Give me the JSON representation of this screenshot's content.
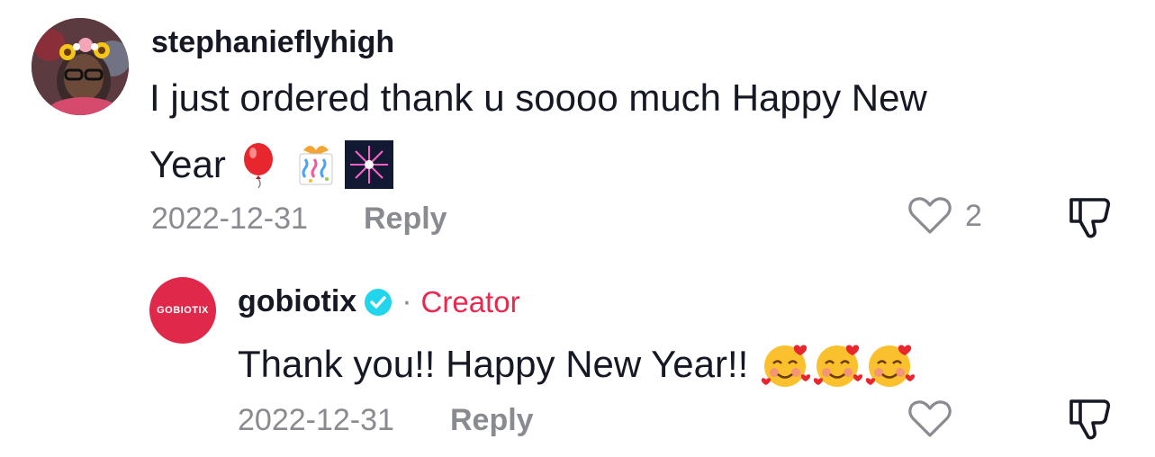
{
  "comment": {
    "username": "stephanieflyhigh",
    "text_line1": "I just ordered thank u soooo much Happy New",
    "text_line2": "Year",
    "emojis": [
      "balloon",
      "party-popper-gift",
      "fireworks"
    ],
    "date": "2022-12-31",
    "reply_label": "Reply",
    "like_count": "2",
    "like_icon": "heart-outline-icon",
    "dislike_icon": "thumbs-down-icon"
  },
  "reply": {
    "avatar_text": "GOBIOTIX",
    "username": "gobiotix",
    "verified_icon": "verified-badge-icon",
    "separator": "·",
    "role": "Creator",
    "text": "Thank you!! Happy New Year!!",
    "emojis": [
      "smiling-face-with-hearts",
      "smiling-face-with-hearts",
      "smiling-face-with-hearts"
    ],
    "date": "2022-12-31",
    "reply_label": "Reply",
    "like_icon": "heart-outline-icon",
    "dislike_icon": "thumbs-down-icon"
  },
  "colors": {
    "text": "#161823",
    "muted": "#8a8b91",
    "creator": "#e8294f",
    "verified": "#20d5ec",
    "brand_avatar": "#e0294a"
  }
}
